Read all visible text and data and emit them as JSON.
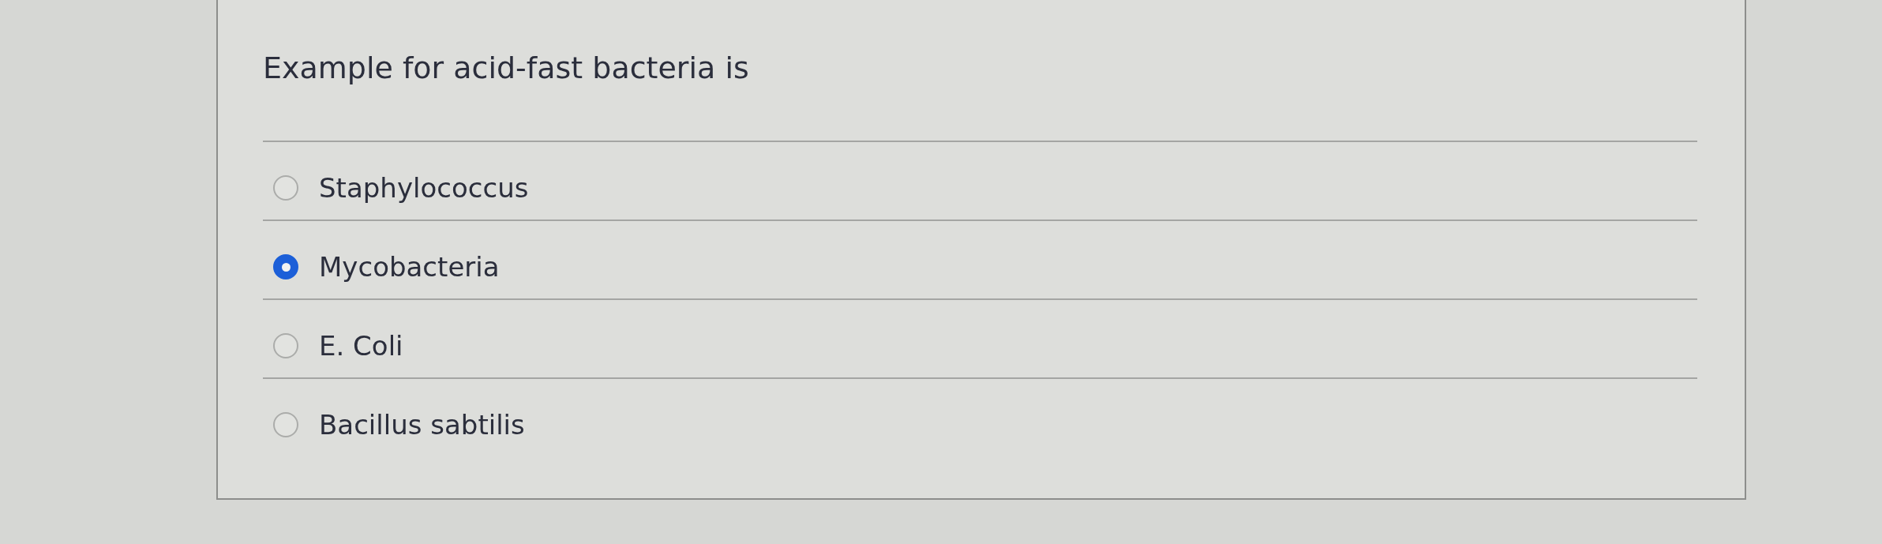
{
  "question": {
    "text": "Example for acid-fast bacteria is"
  },
  "options": [
    {
      "label": "Staphylococcus",
      "selected": false
    },
    {
      "label": "Mycobacteria",
      "selected": true
    },
    {
      "label": "E. Coli",
      "selected": false
    },
    {
      "label": "Bacillus sabtilis",
      "selected": false
    }
  ]
}
